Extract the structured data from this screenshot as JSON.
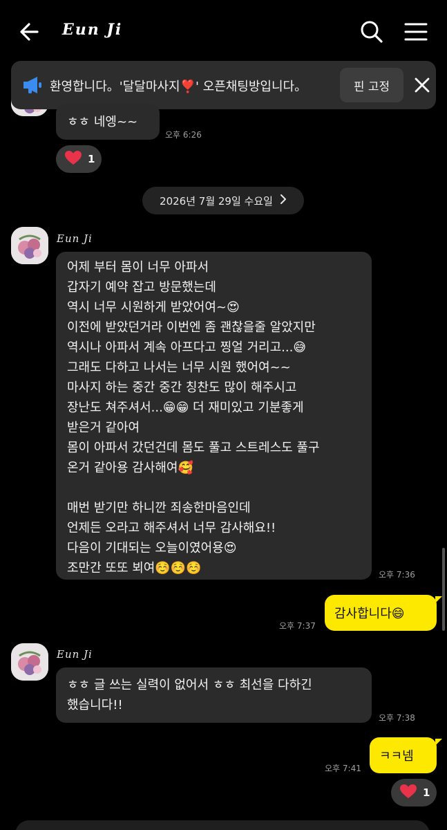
{
  "header": {
    "title": "Eun Ji",
    "back_icon": "arrow-left-icon",
    "search_icon": "search-icon",
    "menu_icon": "hamburger-menu-icon"
  },
  "notice": {
    "text": "환영합니다。'달달마사지❣️' 오픈채팅방입니다。",
    "pin_label": "핀 고정",
    "icon": "megaphone-icon"
  },
  "messages_top": {
    "partial_text": "ㅎㅎ 네엥~~",
    "time": "오후 6:26",
    "reaction_count": "1"
  },
  "date_divider": {
    "label": "2026년 7월 29일 수요일"
  },
  "msg1": {
    "sender": "Eun Ji",
    "lines": [
      "어제 부터 몸이 너무 아파서",
      "갑자기 예약 잡고 방문했는데",
      "역시 너무 시원하게 받았어여~😍",
      "이전에 받았던거라 이번엔 좀 괜찮을줄 알았지만",
      "역시나 아파서 계속 아프다고 찡얼 거리고...😅",
      "그래도 다하고 나서는 너무 시원 했어여~~",
      "마사지 하는 중간 중간 칭찬도 많이 해주시고",
      "장난도 쳐주셔서...😁😁 더 재미있고 기분좋게",
      "받은거 같아여",
      "몸이 아파서 갔던건데 몸도 풀고 스트레스도 풀구",
      "온거 같아용 감사해여🥰",
      "",
      "매번 받기만 하니깐 죄송한마음인데",
      "언제든 오라고 해주셔서 너무 감사해요!!",
      " 다음이 기대되는 오늘이였어용😍",
      " 조만간  또또 뵈여☺️☺️☺️"
    ],
    "time": "오후 7:36"
  },
  "reply1": {
    "text": "감사합니다😄",
    "time": "오후 7:37"
  },
  "msg2": {
    "sender": "Eun Ji",
    "lines": [
      "ㅎㅎ 글 쓰는 실력이 없어서 ㅎㅎ 최선을 다하긴",
      "했습니다!!"
    ],
    "time": "오후 7:38"
  },
  "reply2": {
    "text": "ㅋㅋ넴",
    "time": "오후 7:41",
    "reaction_count": "1"
  },
  "colors": {
    "background": "#000000",
    "incoming_bubble": "#2b2b2b",
    "outgoing_bubble": "#fde900",
    "heart": "#e8334a"
  }
}
